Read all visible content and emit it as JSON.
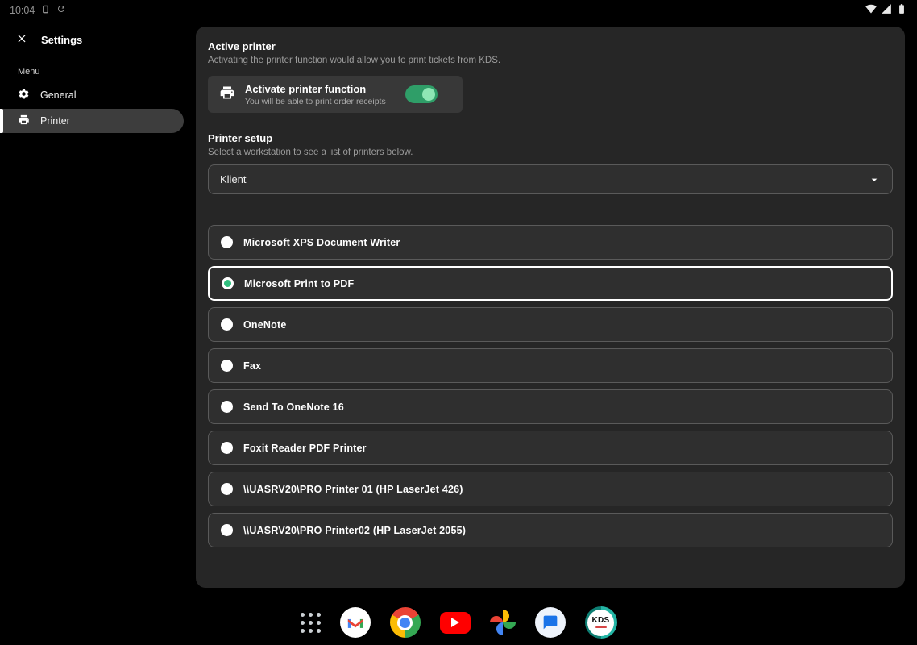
{
  "colors": {
    "accent_green": "#2fbe7d",
    "toggle_track": "#2f9e68",
    "toggle_thumb": "#8ee6b4"
  },
  "status_bar": {
    "time": "10:04"
  },
  "sidebar": {
    "title": "Settings",
    "menu_label": "Menu",
    "items": [
      {
        "label": "General",
        "active": false
      },
      {
        "label": "Printer",
        "active": true
      }
    ]
  },
  "content": {
    "active_printer_section": {
      "title": "Active printer",
      "subtitle": "Activating the printer function would allow you to print tickets from KDS.",
      "toggle_card": {
        "title": "Activate printer function",
        "subtitle": "You will be able to print order receipts",
        "enabled": true
      }
    },
    "printer_setup_section": {
      "title": "Printer setup",
      "subtitle": "Select a workstation to see a list of printers below.",
      "workstation_dropdown_value": "Klient"
    },
    "printers": [
      {
        "name": "Microsoft XPS Document Writer",
        "selected": false
      },
      {
        "name": "Microsoft Print to PDF",
        "selected": true
      },
      {
        "name": "OneNote",
        "selected": false
      },
      {
        "name": "Fax",
        "selected": false
      },
      {
        "name": "Send To OneNote 16",
        "selected": false
      },
      {
        "name": "Foxit Reader PDF Printer",
        "selected": false
      },
      {
        "name": "\\\\UASRV20\\PRO Printer 01 (HP LaserJet 426)",
        "selected": false
      },
      {
        "name": "\\\\UASRV20\\PRO Printer02 (HP LaserJet 2055)",
        "selected": false
      }
    ]
  },
  "taskbar": {
    "kds_label": "KDS",
    "apps": [
      "app-drawer",
      "gmail",
      "chrome",
      "youtube",
      "photos",
      "messages",
      "kds"
    ]
  }
}
